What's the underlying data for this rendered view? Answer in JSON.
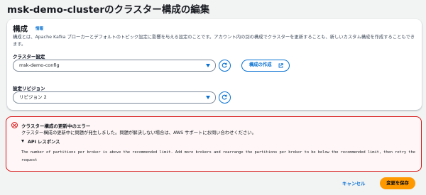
{
  "page": {
    "title": "msk-demo-clusterのクラスター構成の編集"
  },
  "config_section": {
    "title": "構成",
    "info_link": "情報",
    "description": "構成とは、Apache Kafka ブローカーとデフォルトのトピック設定に影響を与える設定のことです。アカウント内の別の構成でクラスターを更新することも、新しいカスタム構成を作成することもできます。",
    "cluster_config": {
      "label": "クラスター設定",
      "value": "msk-demo-config"
    },
    "create_config_label": "構成の作成",
    "revision": {
      "label": "設定リビジョン",
      "value": "リビジョン 2"
    }
  },
  "error_alert": {
    "title": "クラスター構成の更新中のエラー",
    "message": "クラスター構成の更新中に問題が発生しました。問題が解決しない場合は、AWS サポートにお問い合わせください。",
    "expander_label": "API レスポンス",
    "detail": "The number of partitions per broker is above the recommended limit. Add more brokers and rearrange the partitions per broker to be below the recommended limit, then retry the request"
  },
  "footer": {
    "cancel_label": "キャンセル",
    "save_label": "変更を保存"
  },
  "colors": {
    "link_blue": "#0972d3",
    "error_red": "#d91515",
    "primary_orange": "#ff9900"
  }
}
